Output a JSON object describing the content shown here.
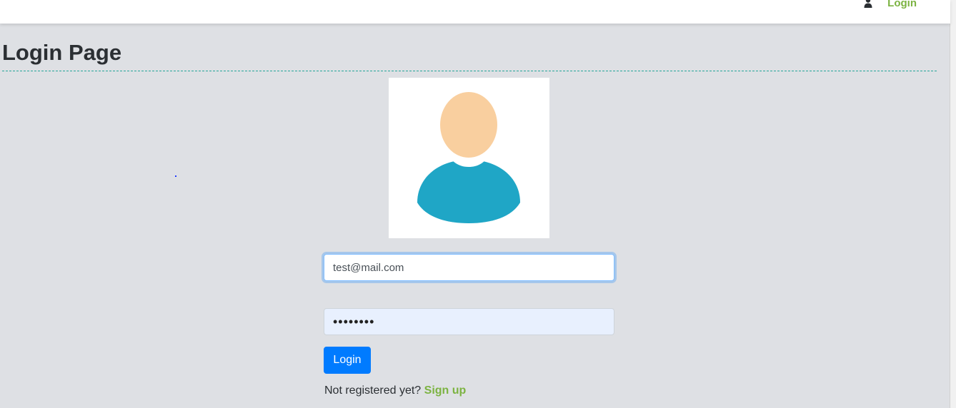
{
  "navbar": {
    "user_icon": "user-icon",
    "login_label": "Login",
    "accent_color": "#7cb342"
  },
  "page": {
    "title": "Login Page",
    "divider_color": "#26a69a",
    "background": "#dee0e4"
  },
  "avatar": {
    "icon": "user-avatar-icon",
    "head_color": "#f9cf9f",
    "body_color": "#1fa6c6"
  },
  "form": {
    "email_value": "test@mail.com",
    "password_value": "••••••••",
    "login_button_label": "Login",
    "button_color": "#007bff"
  },
  "signup": {
    "prompt": "Not registered yet?",
    "link_label": "Sign up"
  }
}
